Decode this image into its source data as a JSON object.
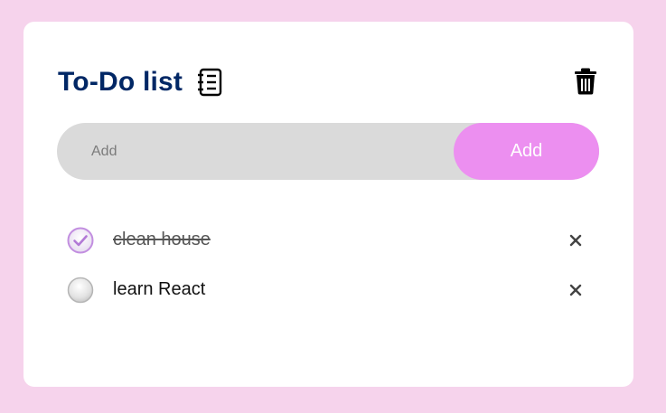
{
  "header": {
    "title": "To-Do list",
    "title_icon": "notebook-icon",
    "clear_icon": "trash-icon"
  },
  "add_form": {
    "placeholder": "Add",
    "button_label": "Add"
  },
  "todos": [
    {
      "text": "clean house",
      "done": true
    },
    {
      "text": "learn React",
      "done": false
    }
  ],
  "colors": {
    "background": "#f6d3ec",
    "card": "#ffffff",
    "title": "#002765",
    "input_bg": "#dadada",
    "accent": "#ec8ff0",
    "check": "#c28ee0"
  }
}
